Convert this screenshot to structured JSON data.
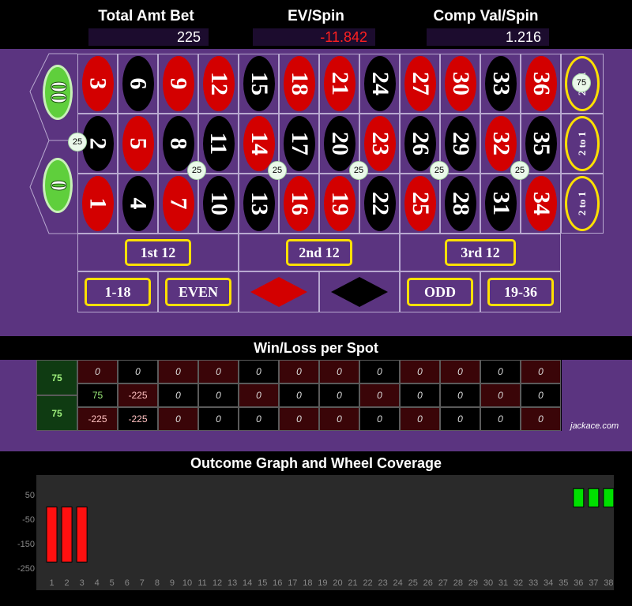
{
  "header": {
    "total_bet_label": "Total Amt Bet",
    "total_bet_value": "225",
    "ev_label": "EV/Spin",
    "ev_value": "-11.842",
    "comp_label": "Comp Val/Spin",
    "comp_value": "1.216"
  },
  "table": {
    "zero": "0",
    "double_zero": "00",
    "rows": [
      [
        {
          "n": "3",
          "c": "red"
        },
        {
          "n": "6",
          "c": "black"
        },
        {
          "n": "9",
          "c": "red"
        },
        {
          "n": "12",
          "c": "red"
        },
        {
          "n": "15",
          "c": "black"
        },
        {
          "n": "18",
          "c": "red"
        },
        {
          "n": "21",
          "c": "red"
        },
        {
          "n": "24",
          "c": "black"
        },
        {
          "n": "27",
          "c": "red"
        },
        {
          "n": "30",
          "c": "red"
        },
        {
          "n": "33",
          "c": "black"
        },
        {
          "n": "36",
          "c": "red"
        }
      ],
      [
        {
          "n": "2",
          "c": "black"
        },
        {
          "n": "5",
          "c": "red"
        },
        {
          "n": "8",
          "c": "black"
        },
        {
          "n": "11",
          "c": "black"
        },
        {
          "n": "14",
          "c": "red"
        },
        {
          "n": "17",
          "c": "black"
        },
        {
          "n": "20",
          "c": "black"
        },
        {
          "n": "23",
          "c": "red"
        },
        {
          "n": "26",
          "c": "black"
        },
        {
          "n": "29",
          "c": "black"
        },
        {
          "n": "32",
          "c": "red"
        },
        {
          "n": "35",
          "c": "black"
        }
      ],
      [
        {
          "n": "1",
          "c": "red"
        },
        {
          "n": "4",
          "c": "black"
        },
        {
          "n": "7",
          "c": "red"
        },
        {
          "n": "10",
          "c": "black"
        },
        {
          "n": "13",
          "c": "black"
        },
        {
          "n": "16",
          "c": "red"
        },
        {
          "n": "19",
          "c": "red"
        },
        {
          "n": "22",
          "c": "black"
        },
        {
          "n": "25",
          "c": "red"
        },
        {
          "n": "28",
          "c": "black"
        },
        {
          "n": "31",
          "c": "black"
        },
        {
          "n": "34",
          "c": "red"
        }
      ]
    ],
    "column_bets": [
      "2 to 1",
      "2 to 1",
      "2 to 1"
    ],
    "dozens": [
      "1st 12",
      "2nd 12",
      "3rd 12"
    ],
    "outside": [
      "1-18",
      "EVEN",
      "ODD",
      "19-36"
    ],
    "chips": {
      "top_column": "75",
      "split_00_2": "25",
      "corner_a": "25",
      "corner_b": "25",
      "corner_c": "25",
      "corner_d": "25",
      "corner_e": "25"
    }
  },
  "winloss": {
    "title": "Win/Loss per Spot",
    "zero_values": [
      "75",
      "75"
    ],
    "rows": [
      [
        "0",
        "0",
        "0",
        "0",
        "0",
        "0",
        "0",
        "0",
        "0",
        "0",
        "0",
        "0"
      ],
      [
        "75",
        "-225",
        "0",
        "0",
        "0",
        "0",
        "0",
        "0",
        "0",
        "0",
        "0",
        "0"
      ],
      [
        "-225",
        "-225",
        "0",
        "0",
        "0",
        "0",
        "0",
        "0",
        "0",
        "0",
        "0",
        "0"
      ]
    ],
    "credit": "jackace.com"
  },
  "graph": {
    "title": "Outcome Graph and Wheel Coverage",
    "y_ticks": [
      "50",
      "-50",
      "-150",
      "-250"
    ],
    "x_ticks": [
      "1",
      "2",
      "3",
      "4",
      "5",
      "6",
      "7",
      "8",
      "9",
      "10",
      "11",
      "12",
      "13",
      "14",
      "15",
      "16",
      "17",
      "18",
      "19",
      "20",
      "21",
      "22",
      "23",
      "24",
      "25",
      "26",
      "27",
      "28",
      "29",
      "30",
      "31",
      "32",
      "33",
      "34",
      "35",
      "36",
      "37",
      "38"
    ],
    "colors": {
      "win": "#00e000",
      "loss": "#ff1010"
    }
  },
  "chart_data": {
    "type": "bar",
    "categories": [
      "1",
      "2",
      "3",
      "4",
      "5",
      "6",
      "7",
      "8",
      "9",
      "10",
      "11",
      "12",
      "13",
      "14",
      "15",
      "16",
      "17",
      "18",
      "19",
      "20",
      "21",
      "22",
      "23",
      "24",
      "25",
      "26",
      "27",
      "28",
      "29",
      "30",
      "31",
      "32",
      "33",
      "34",
      "35",
      "36",
      "37",
      "38"
    ],
    "values": [
      -225,
      -225,
      -225,
      0,
      0,
      0,
      0,
      0,
      0,
      0,
      0,
      0,
      0,
      0,
      0,
      0,
      0,
      0,
      0,
      0,
      0,
      0,
      0,
      0,
      0,
      0,
      0,
      0,
      0,
      0,
      0,
      0,
      0,
      0,
      0,
      75,
      75,
      75
    ],
    "ylim": [
      -250,
      75
    ]
  }
}
